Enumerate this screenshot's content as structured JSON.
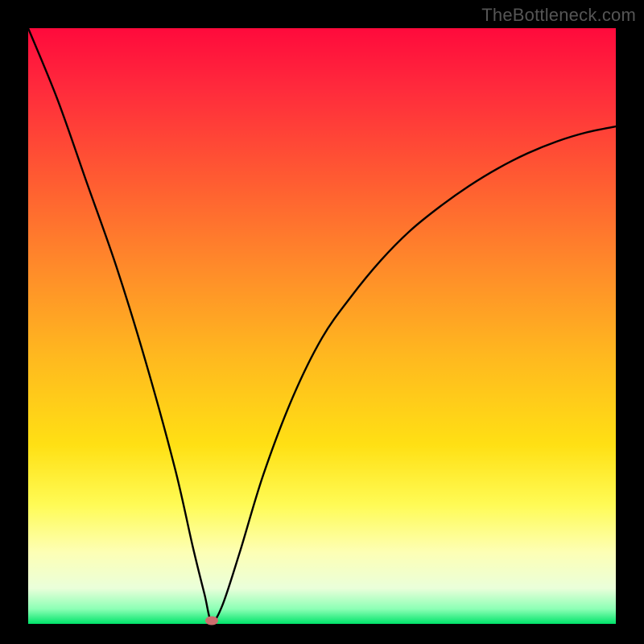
{
  "watermark": "TheBottleneck.com",
  "chart_data": {
    "type": "line",
    "title": "",
    "xlabel": "",
    "ylabel": "",
    "xlim": [
      0,
      1
    ],
    "ylim": [
      0,
      1
    ],
    "series": [
      {
        "name": "bottleneck-curve",
        "x": [
          0.0,
          0.05,
          0.1,
          0.15,
          0.2,
          0.25,
          0.28,
          0.3,
          0.312,
          0.33,
          0.36,
          0.4,
          0.45,
          0.5,
          0.55,
          0.6,
          0.65,
          0.7,
          0.75,
          0.8,
          0.85,
          0.9,
          0.95,
          1.0
        ],
        "values": [
          1.0,
          0.88,
          0.74,
          0.6,
          0.44,
          0.26,
          0.13,
          0.05,
          0.005,
          0.03,
          0.12,
          0.25,
          0.38,
          0.48,
          0.55,
          0.61,
          0.66,
          0.7,
          0.735,
          0.765,
          0.79,
          0.81,
          0.825,
          0.835
        ]
      }
    ],
    "optimum_point": {
      "x": 0.312,
      "y": 0.005
    },
    "gradient_stops": [
      {
        "pos": 0.0,
        "color": "#ff0a3c"
      },
      {
        "pos": 0.25,
        "color": "#ff5a32"
      },
      {
        "pos": 0.55,
        "color": "#ffb81f"
      },
      {
        "pos": 0.8,
        "color": "#fffb55"
      },
      {
        "pos": 0.97,
        "color": "#8cffb5"
      },
      {
        "pos": 1.0,
        "color": "#00e46a"
      }
    ]
  }
}
